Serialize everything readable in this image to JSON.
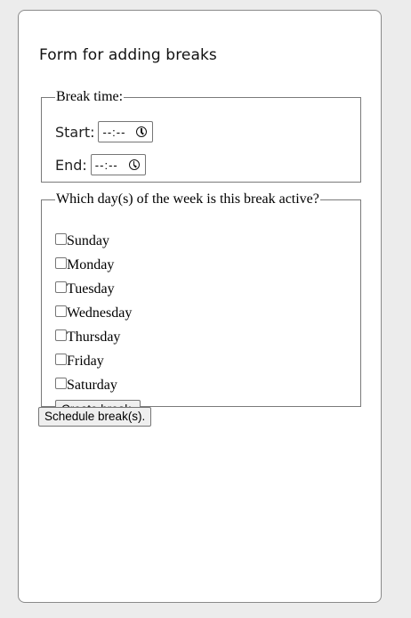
{
  "form": {
    "title": "Form for adding breaks",
    "break_time": {
      "legend": "Break time:",
      "start_label": "Start:",
      "start_value": "--:--",
      "end_label": "End:",
      "end_value": "--:--"
    },
    "days": {
      "legend": "Which day(s) of the week is this break active?",
      "items": [
        {
          "label": "Sunday",
          "checked": false
        },
        {
          "label": "Monday",
          "checked": false
        },
        {
          "label": "Tuesday",
          "checked": false
        },
        {
          "label": "Wednesday",
          "checked": false
        },
        {
          "label": "Thursday",
          "checked": false
        },
        {
          "label": "Friday",
          "checked": false
        },
        {
          "label": "Saturday",
          "checked": false
        }
      ]
    },
    "create_button": "Create break.",
    "schedule_button": "Schedule break(s)."
  },
  "icons": {
    "time_input_icon": "clock-icon"
  }
}
